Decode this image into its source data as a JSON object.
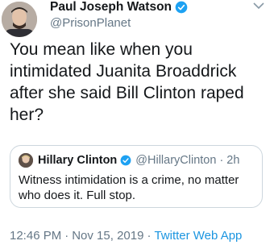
{
  "author": {
    "name": "Paul Joseph Watson",
    "handle": "@PrisonPlanet",
    "verified": true
  },
  "tweet": {
    "text": "You mean like when you intimidated Juanita Broaddrick after she said Bill Clinton raped her?"
  },
  "quoted_tweet": {
    "name": "Hillary Clinton",
    "handle": "@HillaryClinton",
    "separator": "·",
    "time": "2h",
    "verified": true,
    "text": "Witness intimidation is a crime, no matter who does it. Full stop."
  },
  "meta": {
    "time": "12:46 PM",
    "separator": "·",
    "date": "Nov 15, 2019",
    "separator2": "·",
    "app": "Twitter Web App"
  },
  "colors": {
    "accent": "#1da1f2",
    "secondary_text": "#657786",
    "border": "#ccd6dd"
  },
  "icons": {
    "verified": "verified-badge-icon",
    "menu": "chevron-down-icon"
  }
}
